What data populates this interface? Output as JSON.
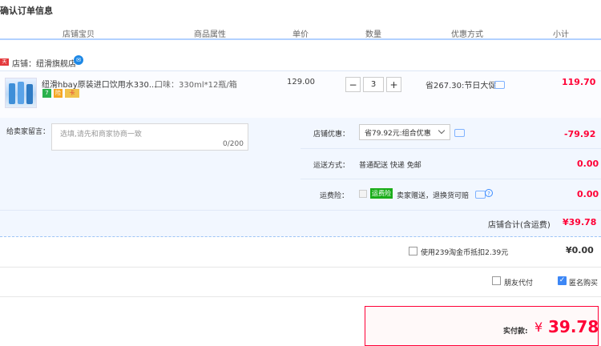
{
  "page": {
    "title": "确认订单信息"
  },
  "columns": [
    "店铺宝贝",
    "商品属性",
    "单价",
    "数量",
    "优惠方式",
    "小计"
  ],
  "shop": {
    "tag": "天猫",
    "name": "店铺：纽滑旗舰店",
    "chat_icon": "wangwang-icon"
  },
  "item": {
    "name": "纽滑hbay原装进口饮用水330...",
    "badges": [
      {
        "text": "7",
        "color": "#2ab24c"
      },
      {
        "text": "险",
        "color": "#f5a623"
      },
      {
        "text": "卡",
        "color": "#e03a3a"
      }
    ],
    "attribute": "口味：330ml*12瓶/箱",
    "unit_price": "129.00",
    "quantity": "3",
    "minus": "−",
    "plus": "+",
    "promo": "省267.30:节日大促",
    "subtotal": "119.70"
  },
  "memo": {
    "label": "给卖家留言：",
    "placeholder": "选填,请先和商家协商一致",
    "counter": "0/200"
  },
  "shop_discount": {
    "label": "店铺优惠：",
    "selected": "省79.92元:组合优惠",
    "value": "-79.92"
  },
  "shipping": {
    "label": "运送方式：",
    "text": "普通配送 快递 免邮",
    "value": "0.00"
  },
  "insurance": {
    "label": "运费险：",
    "tag": "运费险",
    "text": "卖家赠送，退换货可赔",
    "value": "0.00"
  },
  "shop_total": {
    "label": "店铺合计(含运费)",
    "value": "¥39.78"
  },
  "coin": {
    "label": "使用239淘金币抵扣2.39元",
    "value": "¥0.00"
  },
  "options": {
    "friend_pay": "朋友代付",
    "anonymous": "匿名购买"
  },
  "payment": {
    "label": "实付款:",
    "currency": "¥",
    "amount": "39.78"
  },
  "colors": {
    "accent": "#ff0036",
    "blue": "#3d87f5",
    "panel": "#f2f7ff"
  }
}
